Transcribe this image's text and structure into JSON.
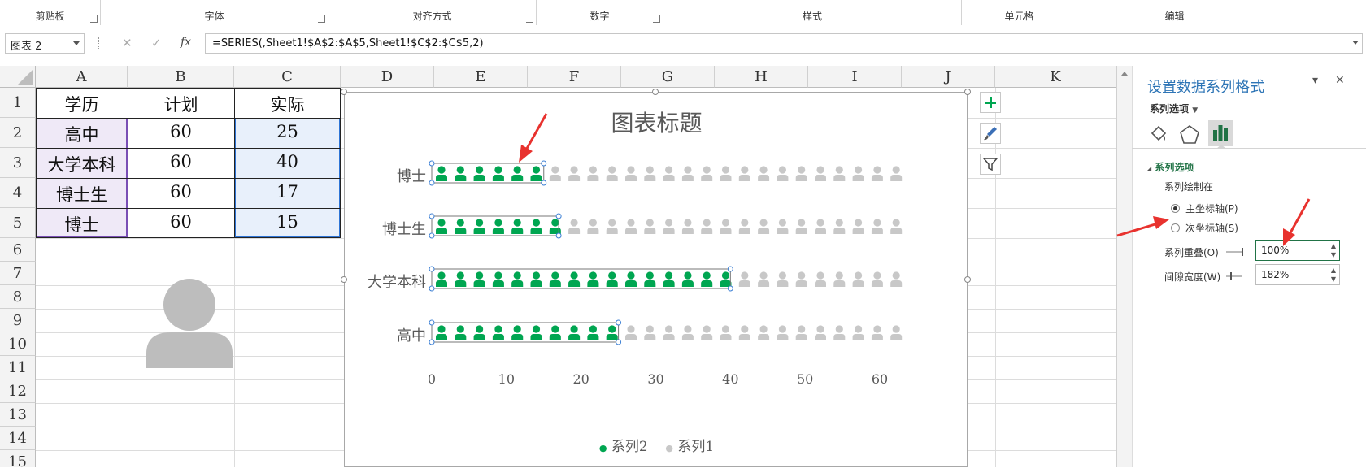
{
  "ribbon": {
    "groups": [
      "剪贴板",
      "字体",
      "对齐方式",
      "数字",
      "样式",
      "单元格",
      "编辑"
    ]
  },
  "formula_bar": {
    "name_box": "图表 2",
    "formula": "=SERIES(,Sheet1!$A$2:$A$5,Sheet1!$C$2:$C$5,2)",
    "cancel_icon": "✕",
    "enter_icon": "✓",
    "fx_icon": "fx"
  },
  "sheet": {
    "columns": [
      "A",
      "B",
      "C",
      "D",
      "E",
      "F",
      "G",
      "H",
      "I",
      "J",
      "K"
    ],
    "rows": [
      "1",
      "2",
      "3",
      "4",
      "5",
      "6",
      "7",
      "8",
      "9",
      "10",
      "11",
      "12",
      "13",
      "14",
      "15"
    ],
    "header_row": [
      "学历",
      "计划",
      "实际"
    ],
    "data": [
      [
        "高中",
        "60",
        "25"
      ],
      [
        "大学本科",
        "60",
        "40"
      ],
      [
        "博士生",
        "60",
        "17"
      ],
      [
        "博士",
        "60",
        "15"
      ]
    ]
  },
  "chart_data": {
    "type": "bar",
    "title": "图表标题",
    "categories": [
      "博士",
      "博士生",
      "大学本科",
      "高中"
    ],
    "series": [
      {
        "name": "系列2",
        "values": [
          15,
          17,
          40,
          25
        ],
        "color": "#00a651"
      },
      {
        "name": "系列1",
        "values": [
          60,
          60,
          60,
          60
        ],
        "color": "#c8c8c8"
      }
    ],
    "xlim": [
      0,
      60
    ],
    "xticks": [
      "0",
      "10",
      "20",
      "30",
      "40",
      "50",
      "60"
    ],
    "legend_position": "bottom",
    "orientation": "horizontal"
  },
  "chart_buttons": [
    "plus-icon",
    "brush-icon",
    "filter-icon"
  ],
  "pane": {
    "title": "设置数据系列格式",
    "dropdown_label": "系列选项",
    "section_title": "系列选项",
    "plot_on_label": "系列绘制在",
    "primary_axis": "主坐标轴(P)",
    "secondary_axis": "次坐标轴(S)",
    "overlap_label": "系列重叠(O)",
    "overlap_value": "100%",
    "gap_label": "间隙宽度(W)",
    "gap_value": "182%",
    "close_icon": "✕",
    "menu_icon": "▾"
  },
  "colors": {
    "accent": "#00a651",
    "ghost": "#c8c8c8",
    "annotation": "#e8322e"
  }
}
